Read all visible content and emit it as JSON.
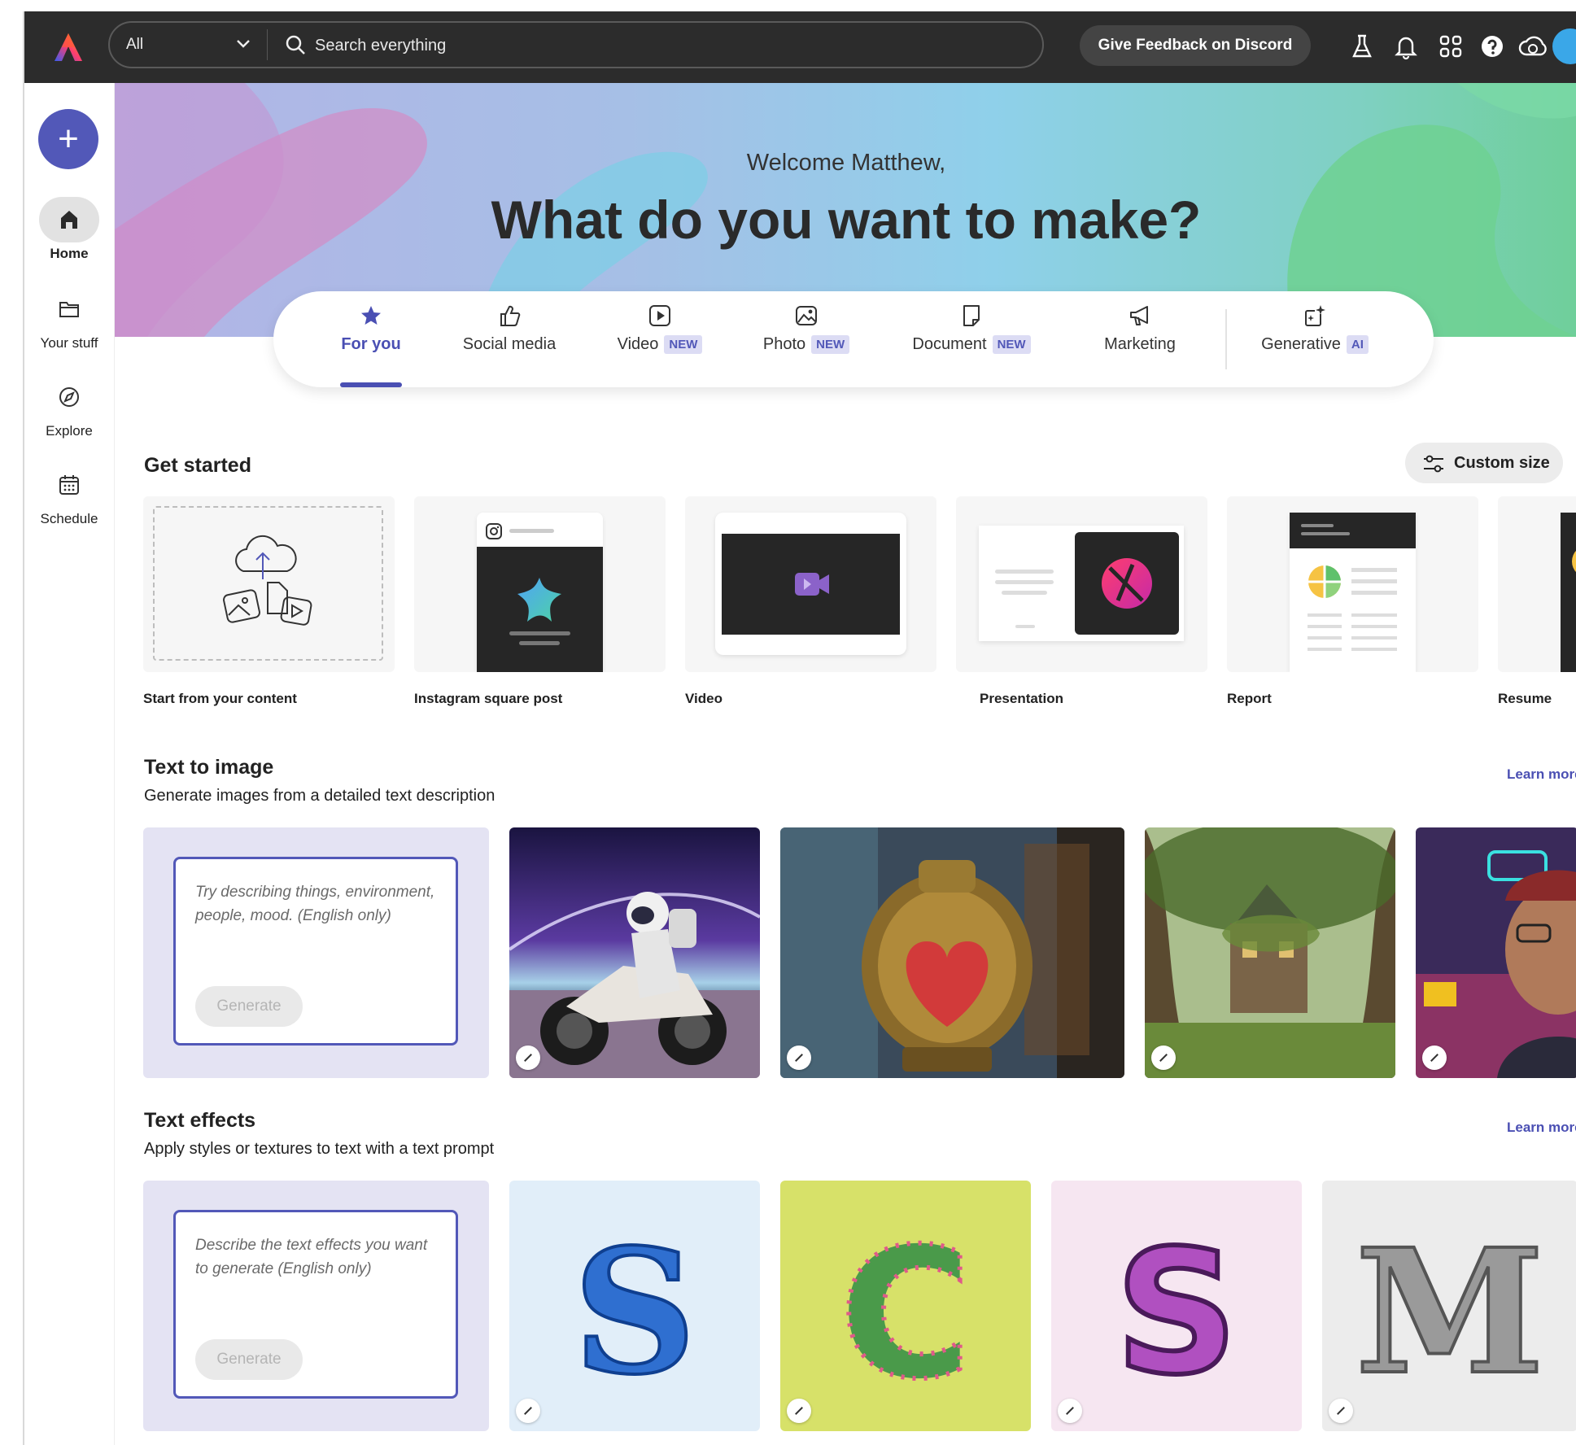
{
  "colors": {
    "accent": "#5258b8",
    "topbar": "#2c2c2c",
    "badge_bg": "#dcdcf4"
  },
  "search": {
    "scope": "All",
    "placeholder": "Search everything"
  },
  "topbar": {
    "feedback_label": "Give Feedback on Discord",
    "icons": [
      "labs-icon",
      "bell-icon",
      "apps-grid-icon",
      "help-icon",
      "creative-cloud-icon"
    ]
  },
  "sidebar": {
    "create_label": "+",
    "items": [
      {
        "label": "Home",
        "icon": "home-icon",
        "active": true
      },
      {
        "label": "Your stuff",
        "icon": "folder-icon"
      },
      {
        "label": "Explore",
        "icon": "compass-icon"
      },
      {
        "label": "Schedule",
        "icon": "calendar-icon"
      }
    ]
  },
  "hero": {
    "welcome": "Welcome Matthew,",
    "headline": "What do you want to make?"
  },
  "tabs": [
    {
      "label": "For you",
      "icon": "star-icon",
      "active": true
    },
    {
      "label": "Social media",
      "icon": "thumbs-up-icon"
    },
    {
      "label": "Video",
      "badge": "NEW",
      "icon": "play-icon"
    },
    {
      "label": "Photo",
      "badge": "NEW",
      "icon": "photo-icon"
    },
    {
      "label": "Document",
      "badge": "NEW",
      "icon": "document-icon"
    },
    {
      "label": "Marketing",
      "icon": "megaphone-icon"
    },
    {
      "label": "Generative",
      "badge": "AI",
      "icon": "sparkle-image-icon"
    }
  ],
  "get_started": {
    "title": "Get started",
    "custom_size": "Custom size",
    "cards": [
      {
        "label": "Start from your content"
      },
      {
        "label": "Instagram square post"
      },
      {
        "label": "Video"
      },
      {
        "label": "Presentation"
      },
      {
        "label": "Report"
      },
      {
        "label": "Resume"
      }
    ]
  },
  "text_to_image": {
    "title": "Text to image",
    "subtitle": "Generate images from a detailed text description",
    "learn_more": "Learn more",
    "placeholder": "Try describing things, environment, people, mood. (English only)",
    "generate": "Generate"
  },
  "text_effects": {
    "title": "Text effects",
    "subtitle": "Apply styles or textures to text with a text prompt",
    "learn_more": "Learn more",
    "placeholder": "Describe the text effects you want to generate (English only)",
    "generate": "Generate",
    "letters": [
      "S",
      "C",
      "S",
      "M"
    ]
  }
}
